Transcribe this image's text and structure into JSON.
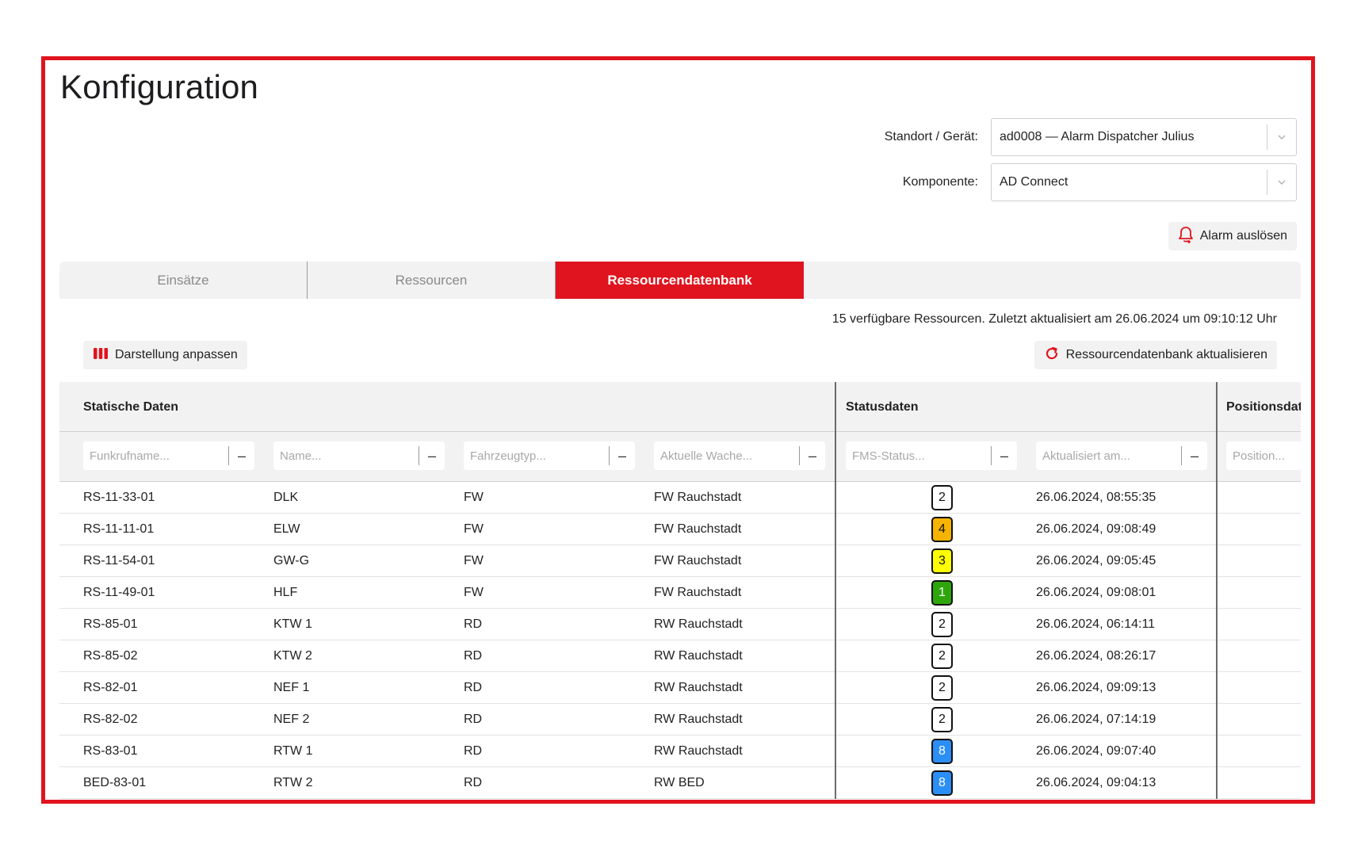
{
  "page": {
    "title": "Konfiguration"
  },
  "fields": {
    "standort": {
      "label": "Standort / Gerät:",
      "value": "ad0008 — Alarm Dispatcher Julius"
    },
    "komponente": {
      "label": "Komponente:",
      "value": "AD Connect"
    }
  },
  "alarm_button": {
    "label": "Alarm auslösen"
  },
  "tabs": [
    {
      "label": "Einsätze",
      "active": false
    },
    {
      "label": "Ressourcen",
      "active": false
    },
    {
      "label": "Ressourcendatenbank",
      "active": true
    }
  ],
  "info_line": "15 verfügbare Ressourcen. Zuletzt aktualisiert am 26.06.2024 um 09:10:12 Uhr",
  "toolbar": {
    "layout_button": "Darstellung anpassen",
    "refresh_button": "Ressourcendatenbank aktualisieren"
  },
  "table": {
    "groups": [
      "Statische Daten",
      "Statusdaten",
      "Positionsdat"
    ],
    "filters": [
      "Funkrufname...",
      "Name...",
      "Fahrzeugtyp...",
      "Aktuelle Wache...",
      "FMS-Status...",
      "Aktualisiert am...",
      "Position..."
    ],
    "filter_clear": "–",
    "rows": [
      {
        "funkrufname": "RS-11-33-01",
        "name": "DLK",
        "typ": "FW",
        "wache": "FW Rauchstadt",
        "fms": "2",
        "fms_color": "#ffffff",
        "aktualisiert": "26.06.2024, 08:55:35"
      },
      {
        "funkrufname": "RS-11-11-01",
        "name": "ELW",
        "typ": "FW",
        "wache": "FW Rauchstadt",
        "fms": "4",
        "fms_color": "#f5b400",
        "aktualisiert": "26.06.2024, 09:08:49"
      },
      {
        "funkrufname": "RS-11-54-01",
        "name": "GW-G",
        "typ": "FW",
        "wache": "FW Rauchstadt",
        "fms": "3",
        "fms_color": "#ffff00",
        "aktualisiert": "26.06.2024, 09:05:45"
      },
      {
        "funkrufname": "RS-11-49-01",
        "name": "HLF",
        "typ": "FW",
        "wache": "FW Rauchstadt",
        "fms": "1",
        "fms_color": "#2ea60b",
        "aktualisiert": "26.06.2024, 09:08:01"
      },
      {
        "funkrufname": "RS-85-01",
        "name": "KTW 1",
        "typ": "RD",
        "wache": "RW Rauchstadt",
        "fms": "2",
        "fms_color": "#ffffff",
        "aktualisiert": "26.06.2024, 06:14:11"
      },
      {
        "funkrufname": "RS-85-02",
        "name": "KTW 2",
        "typ": "RD",
        "wache": "RW Rauchstadt",
        "fms": "2",
        "fms_color": "#ffffff",
        "aktualisiert": "26.06.2024, 08:26:17"
      },
      {
        "funkrufname": "RS-82-01",
        "name": "NEF 1",
        "typ": "RD",
        "wache": "RW Rauchstadt",
        "fms": "2",
        "fms_color": "#ffffff",
        "aktualisiert": "26.06.2024, 09:09:13"
      },
      {
        "funkrufname": "RS-82-02",
        "name": "NEF 2",
        "typ": "RD",
        "wache": "RW Rauchstadt",
        "fms": "2",
        "fms_color": "#ffffff",
        "aktualisiert": "26.06.2024, 07:14:19"
      },
      {
        "funkrufname": "RS-83-01",
        "name": "RTW 1",
        "typ": "RD",
        "wache": "RW Rauchstadt",
        "fms": "8",
        "fms_color": "#2b8ef5",
        "aktualisiert": "26.06.2024, 09:07:40"
      },
      {
        "funkrufname": "BED-83-01",
        "name": "RTW 2",
        "typ": "RD",
        "wache": "RW BED",
        "fms": "8",
        "fms_color": "#2b8ef5",
        "aktualisiert": "26.06.2024, 09:04:13"
      }
    ]
  },
  "colors": {
    "accent": "#e0141e",
    "panel_bg": "#f2f2f2"
  }
}
